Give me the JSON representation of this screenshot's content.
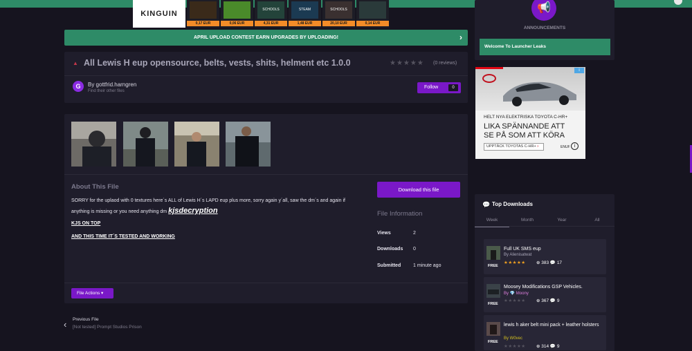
{
  "banner": {
    "logo": "KINGUIN",
    "games": [
      {
        "label": "",
        "price": "0,17 EUR",
        "color": "#3a2a1a"
      },
      {
        "label": "",
        "price": "0,06 EUR",
        "color": "#4a8a2a"
      },
      {
        "label": "SCHOOLS",
        "price": "4,31 EUR",
        "color": "#23433a"
      },
      {
        "label": "STEAM",
        "price": "1,48 EUR",
        "color": "#1b3a52"
      },
      {
        "label": "SCHOOLS",
        "price": "20,10 EUR",
        "color": "#3a3030"
      },
      {
        "label": "",
        "price": "0,14 EUR",
        "color": "#2a3a3a"
      }
    ]
  },
  "contest": {
    "text": "APRIL UPLOAD CONTEST EARN UPGRADES BY UPLOADING!",
    "arrow": "›"
  },
  "file": {
    "title": "All Lewis H eup opensource, belts, vests, shits, helment etc 1.0.0",
    "warn_icon": "▲",
    "stars": "★★★★★",
    "reviews": "(0 reviews)",
    "avatar_letter": "G",
    "by": "By gottfrid.harngren",
    "find_other": "Find their other files",
    "follow_label": "Follow",
    "follow_count": "0"
  },
  "about": {
    "heading": "About This File",
    "desc_part1": "SORRY for the uplaod with 0 textures here´s ALL of Lewis H´s LAPD eup plus more, sorry again y´all, saw the dm´s and again if anything is missing or you need anything dm ",
    "desc_link": "kjsdecryption",
    "line2": "KJS ON TOP",
    "line3": "AND THIS TIME IT´S TESTED  AND WORKING"
  },
  "download_button": "Download this file",
  "file_info": {
    "heading": "File Information",
    "rows": [
      {
        "key": "Views",
        "value": "2"
      },
      {
        "key": "Downloads",
        "value": "0"
      },
      {
        "key": "Submitted",
        "value": "1 minute ago"
      }
    ]
  },
  "file_actions": "File Actions ▾",
  "previous": {
    "arrow": "‹",
    "label": "Previous File",
    "name": "[Not tested] Prompt Studios Prison"
  },
  "announcements": {
    "icon": "📢",
    "title": "ANNOUNCEMENTS",
    "item": "Welcome To Launcher Leaks"
  },
  "ad": {
    "line1": "HELT NYA ELEKTRISKA TOYOTA C-HR+",
    "line2": "LIKA SPÄNNANDE ATT",
    "line3": "SE PÅ SOM ATT KÖRA",
    "cta": "UPPTÄCK TOYOTAS C-HR+",
    "cta_arrow": "›",
    "info": "i",
    "small": "ENUF"
  },
  "top_downloads": {
    "icon": "💬",
    "title": "Top Downloads",
    "tabs": [
      "Week",
      "Month",
      "Year",
      "All"
    ],
    "items": [
      {
        "name": "Full UK SMS eup",
        "by": "By Alienisatwat",
        "free": "FREE",
        "stars": "★★★★★",
        "star_color": "#f0a020",
        "downloads": "⊕ 383",
        "comments": "💬 17"
      },
      {
        "name": "Moosey Modifications GSP Vehicles.",
        "by": "By 💎 Moony",
        "free": "FREE",
        "stars": "★★★★★",
        "star_color": "#55535f",
        "downloads": "⊕ 367",
        "comments": "💬 9"
      },
      {
        "name": "lewis h aker belt mini pack + leather holsters",
        "by": "By W0vec",
        "free": "FREE",
        "stars": "★★★★★",
        "star_color": "#55535f",
        "downloads": "⊕ 314",
        "comments": "💬 9"
      }
    ]
  }
}
